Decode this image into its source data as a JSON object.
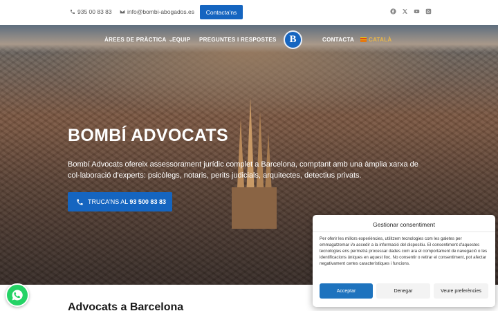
{
  "topbar": {
    "phone": "935 00 83 83",
    "email": "info@bombi-abogados.es",
    "cta_label": "Contacta'ns",
    "social_icons": [
      "facebook-icon",
      "x-icon",
      "youtube-icon",
      "rss-icon"
    ]
  },
  "nav": {
    "items": [
      {
        "label": "ÀREES DE PRÀCTICA",
        "has_dropdown": true
      },
      {
        "label": "EQUIP"
      },
      {
        "label": "PREGUNTES I RESPOSTES"
      },
      {
        "label": "CONTACTA"
      }
    ],
    "language": "CATALÀ",
    "logo_letter": "B"
  },
  "hero": {
    "title": "BOMBÍ ADVOCATS",
    "text": "Bombí Advocats ofereix assessorament jurídic complet a Barcelona, comptant amb una àmplia xarxa de col·laboració d'experts: psicòlegs, notaris, perits judicials, arquitectes, detectius privats.",
    "button_label": "TRUCA'NS AL ",
    "button_number": "93 500 83 83"
  },
  "section": {
    "title": "Advocats a Barcelona"
  },
  "consent": {
    "title": "Gestionar consentiment",
    "text": "Per oferir les millors experiències, utilitzem tecnologies com les galetes per emmagatzemar i/o accedir a la informació del dispositiu. El consentiment d'aquestes tecnologies ens permetrà processar dades com ara el comportament de navegació o les identificacions úniques en aquest lloc. No consentir o retirar el consentiment, pot afectar negativament certes característiques i funcions.",
    "accept": "Acceptar",
    "deny": "Denegar",
    "prefs": "Veure preferències"
  },
  "colors": {
    "primary": "#1565c0",
    "whatsapp": "#25d366",
    "lang": "#e8b64a"
  }
}
